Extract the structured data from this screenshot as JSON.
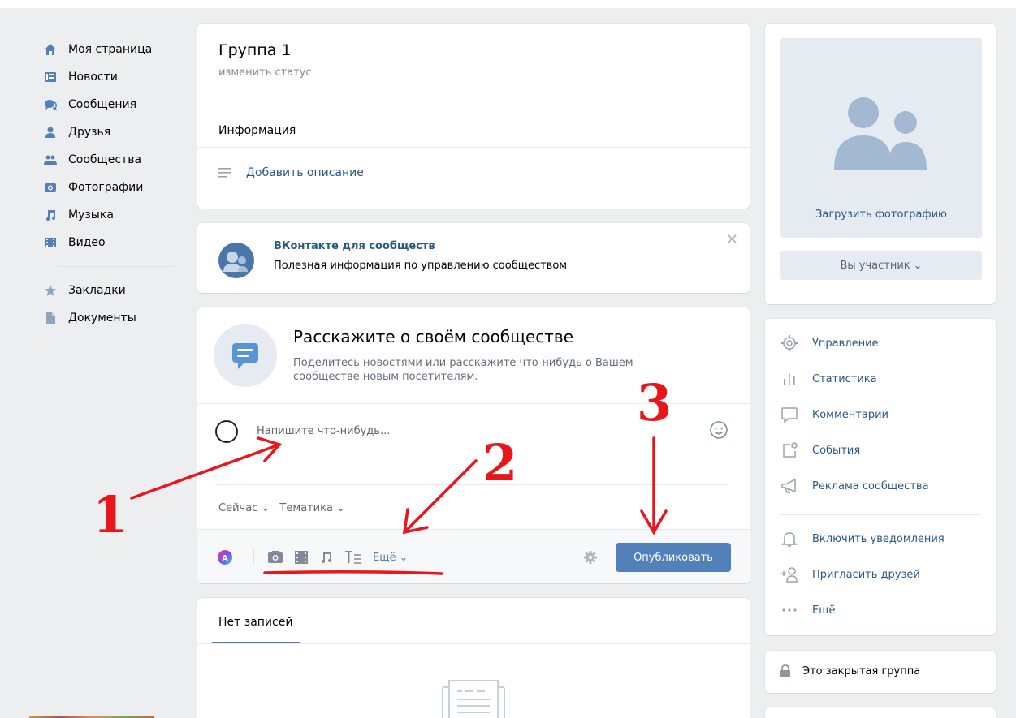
{
  "nav": {
    "items": [
      {
        "label": "Моя страница",
        "icon": "home-icon"
      },
      {
        "label": "Новости",
        "icon": "news-icon"
      },
      {
        "label": "Сообщения",
        "icon": "messages-icon"
      },
      {
        "label": "Друзья",
        "icon": "friends-icon"
      },
      {
        "label": "Сообщества",
        "icon": "communities-icon"
      },
      {
        "label": "Фотографии",
        "icon": "photos-icon"
      },
      {
        "label": "Музыка",
        "icon": "music-icon"
      },
      {
        "label": "Видео",
        "icon": "video-icon"
      }
    ],
    "extra": [
      {
        "label": "Закладки",
        "icon": "star-icon"
      },
      {
        "label": "Документы",
        "icon": "document-icon"
      }
    ]
  },
  "group": {
    "title": "Группа 1",
    "status": "изменить статус",
    "info_label": "Информация",
    "add_description": "Добавить описание"
  },
  "promo": {
    "title": "ВКонтакте для сообществ",
    "text": "Полезная информация по управлению сообществом"
  },
  "composer": {
    "title": "Расскажите о своём сообществе",
    "text": "Поделитесь новостями или расскажите что-нибудь о Вашем сообществе новым посетителям.",
    "placeholder": "Напишите что-нибудь...",
    "time_option": "Сейчас",
    "topic_option": "Тематика",
    "more_label": "Ещё",
    "publish_label": "Опубликовать"
  },
  "feed": {
    "tab": "Нет записей"
  },
  "sidebar": {
    "upload_photo": "Загрузить фотографию",
    "member_button": "Вы участник",
    "actions": [
      {
        "label": "Управление",
        "icon": "gear-icon"
      },
      {
        "label": "Статистика",
        "icon": "stats-icon"
      },
      {
        "label": "Комментарии",
        "icon": "comment-icon"
      },
      {
        "label": "События",
        "icon": "events-icon"
      },
      {
        "label": "Реклама сообщества",
        "icon": "megaphone-icon"
      },
      {
        "label": "Включить уведомления",
        "icon": "bell-icon"
      },
      {
        "label": "Пригласить друзей",
        "icon": "add-user-icon"
      },
      {
        "label": "Ещё",
        "icon": "more-icon"
      }
    ],
    "closed_group": "Это закрытая группа"
  },
  "annotations": {
    "labels": [
      "1",
      "2",
      "3"
    ],
    "color": "#e8161b"
  },
  "colors": {
    "accent": "#5181b8",
    "link": "#2a5885",
    "background": "#edeef0"
  }
}
